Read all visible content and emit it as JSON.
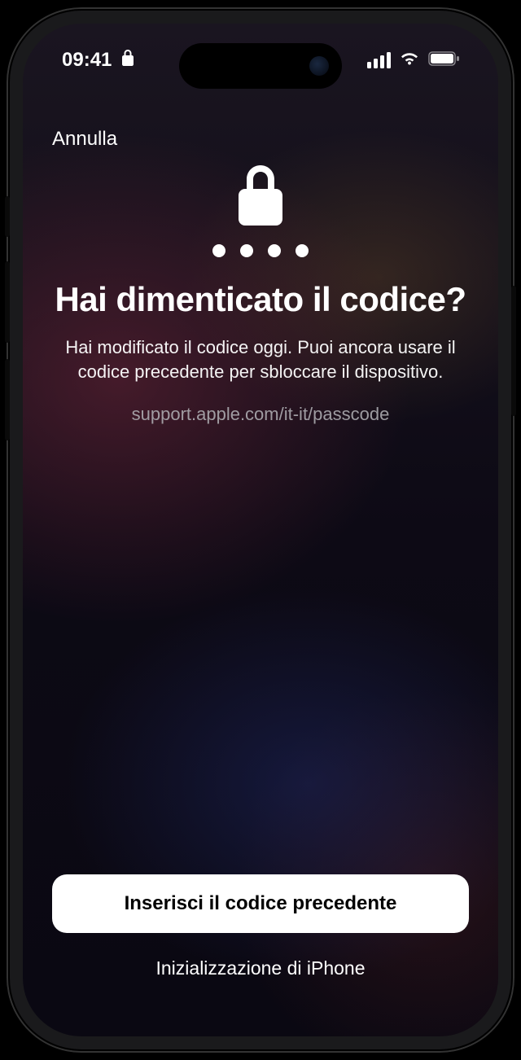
{
  "status_bar": {
    "time": "09:41"
  },
  "header": {
    "cancel": "Annulla"
  },
  "main": {
    "title": "Hai dimenticato il codice?",
    "description": "Hai modificato il codice oggi. Puoi ancora usare il codice precedente per sbloccare il dispositivo.",
    "support_url": "support.apple.com/it-it/passcode"
  },
  "actions": {
    "primary": "Inserisci il codice precedente",
    "secondary": "Inizializzazione di iPhone"
  }
}
